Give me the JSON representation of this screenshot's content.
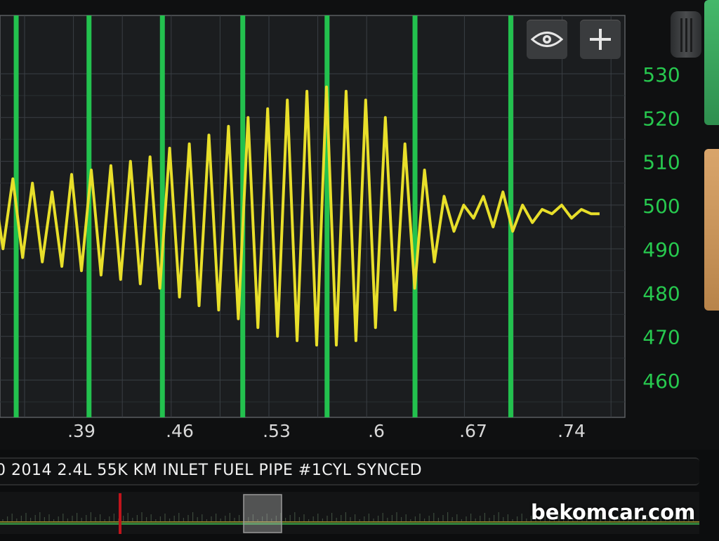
{
  "toolbar": {
    "eye_icon": "eye-icon",
    "plus_icon": "plus-icon"
  },
  "title": "0 2014 2.4L 55K KM INLET FUEL PIPE #1CYL SYNCED",
  "watermark": "bekomcar.com",
  "colors": {
    "trace": "#e8df2a",
    "markers": "#23c14e",
    "axis_text": "#27c94f",
    "grid": "#3a3f44",
    "cursor": "#c0141c"
  },
  "chart_data": {
    "type": "line",
    "x_ticks": [
      ".39",
      ".46",
      ".53",
      ".6",
      ".67",
      ".74"
    ],
    "y_ticks": [
      "530",
      "520",
      "510",
      "500",
      "490",
      "480",
      "470",
      "460"
    ],
    "y_range": [
      460,
      530
    ],
    "x_range": [
      0.32,
      0.76
    ],
    "grid": true,
    "marker_x": [
      0.3434,
      0.3954,
      0.4478,
      0.5052,
      0.5654,
      0.6282,
      0.6966
    ],
    "series": [
      {
        "x": [
          0.32,
          0.327,
          0.334,
          0.341,
          0.348,
          0.355,
          0.362,
          0.369,
          0.376,
          0.383,
          0.39,
          0.397,
          0.404,
          0.411,
          0.418,
          0.425,
          0.432,
          0.439,
          0.446,
          0.453,
          0.46,
          0.467,
          0.474,
          0.481,
          0.488,
          0.495,
          0.502,
          0.509,
          0.516,
          0.523,
          0.53,
          0.537,
          0.544,
          0.551,
          0.558,
          0.565,
          0.572,
          0.579,
          0.586,
          0.593,
          0.6,
          0.607,
          0.614,
          0.621,
          0.628,
          0.635,
          0.642,
          0.649,
          0.656,
          0.663,
          0.67,
          0.677,
          0.684,
          0.691,
          0.698,
          0.705,
          0.712,
          0.719,
          0.726,
          0.733,
          0.74,
          0.747,
          0.754,
          0.76
        ],
        "y": [
          500,
          505,
          490,
          506,
          488,
          505,
          487,
          503,
          486,
          507,
          485,
          508,
          484,
          509,
          483,
          510,
          482,
          511,
          481,
          513,
          479,
          514,
          477,
          516,
          476,
          518,
          474,
          520,
          472,
          522,
          470,
          524,
          469,
          526,
          468,
          527,
          468,
          526,
          469,
          524,
          472,
          520,
          476,
          514,
          481,
          508,
          487,
          502,
          494,
          500,
          497,
          502,
          495,
          503,
          494,
          500,
          496,
          499,
          498,
          500,
          497,
          499,
          498,
          498
        ]
      }
    ]
  }
}
